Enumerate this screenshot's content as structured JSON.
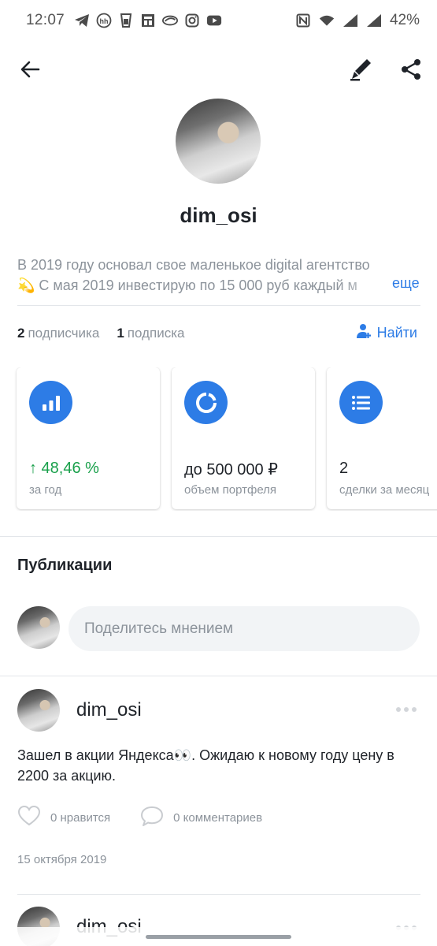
{
  "status_bar": {
    "time": "12:07",
    "left_icons": [
      "telegram-icon",
      "hh-icon",
      "cup-icon",
      "news-icon",
      "sber-icon",
      "instagram-icon",
      "youtube-icon"
    ],
    "right_icons": [
      "nfc-icon",
      "wifi-icon",
      "signal-icon",
      "signal-icon"
    ],
    "battery": "42%"
  },
  "appbar": {
    "icons": [
      "back-arrow-icon",
      "edit-pen-icon",
      "share-icon"
    ]
  },
  "profile": {
    "username": "dim_osi",
    "bio_line1": "В 2019 году основал свое маленькое digital агентство",
    "bio_line2": "💫 С мая 2019 инвестирую по 15 000 руб каждый м",
    "bio_more": "еще",
    "followers_count": "2",
    "followers_label": "подписчика",
    "following_count": "1",
    "following_label": "подписка",
    "find_label": "Найти"
  },
  "stats": [
    {
      "icon": "bar-chart-icon",
      "value": "↑ 48,46 %",
      "label": "за год",
      "accent": "#19a04b"
    },
    {
      "icon": "pie-progress-icon",
      "value": "до 500 000 ₽",
      "label": "объем портфеля"
    },
    {
      "icon": "list-icon",
      "value": "2",
      "label": "сделки за месяц"
    }
  ],
  "publications": {
    "title": "Публикации",
    "composer_placeholder": "Поделитесь мнением"
  },
  "posts": [
    {
      "author": "dim_osi",
      "text": "Зашел в акции Яндекса👀. Ожидаю к новому году цену в 2200 за акцию.",
      "likes_label": "0 нравится",
      "comments_label": "0 комментариев",
      "date": "15 октября 2019"
    },
    {
      "author": "dim_osi"
    }
  ],
  "colors": {
    "accent": "#2d7ce6",
    "positive": "#19a04b",
    "muted_text": "#8c939b"
  }
}
